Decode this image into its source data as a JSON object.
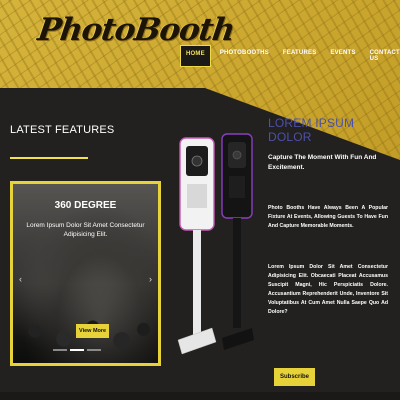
{
  "logo": {
    "text": "PhotoBooth"
  },
  "nav": {
    "items": [
      {
        "label": "HOME",
        "active": true
      },
      {
        "label": "PHOTOBOOTHS",
        "active": false
      },
      {
        "label": "FEATURES",
        "active": false
      },
      {
        "label": "EVENTS",
        "active": false
      },
      {
        "label": "CONTACT US",
        "active": false
      }
    ]
  },
  "latest": {
    "title": "LATEST FEATURES",
    "slide": {
      "title": "360 DEGREE",
      "subtitle": "Lorem Ipsum Dolor Sit Amet Consectetur Adipisicing Elit.",
      "button": "View More",
      "arrow_left": "‹",
      "arrow_right": "›",
      "dots": 3,
      "active_dot": 1
    }
  },
  "info": {
    "title": "LOREM IPSUM DOLOR",
    "subtitle": "Capture The Moment With Fun And Excitement.",
    "para1": "Photo Booths Have Always Been A Popular Fixture At Events, Allowing Guests To Have Fun And Capture Memorable Moments.",
    "para2": "Lorem Ipsum Dolor Sit Amet Consectetur Adipisicing Elit. Obcaecati Placeat Accusamus Suscipit Magni, Hic Perspiciatis Dolore. Accusantium Reprehenderit Unde, Inventore Sit Voluptatibus At Cum Amet Nulla Saepe Quo Ad Dolore?",
    "button": "Subscribe"
  },
  "colors": {
    "accent": "#e8d23a",
    "title_blue": "#4c50a8",
    "gold": "#c9a42c",
    "bg": "#22211f"
  }
}
